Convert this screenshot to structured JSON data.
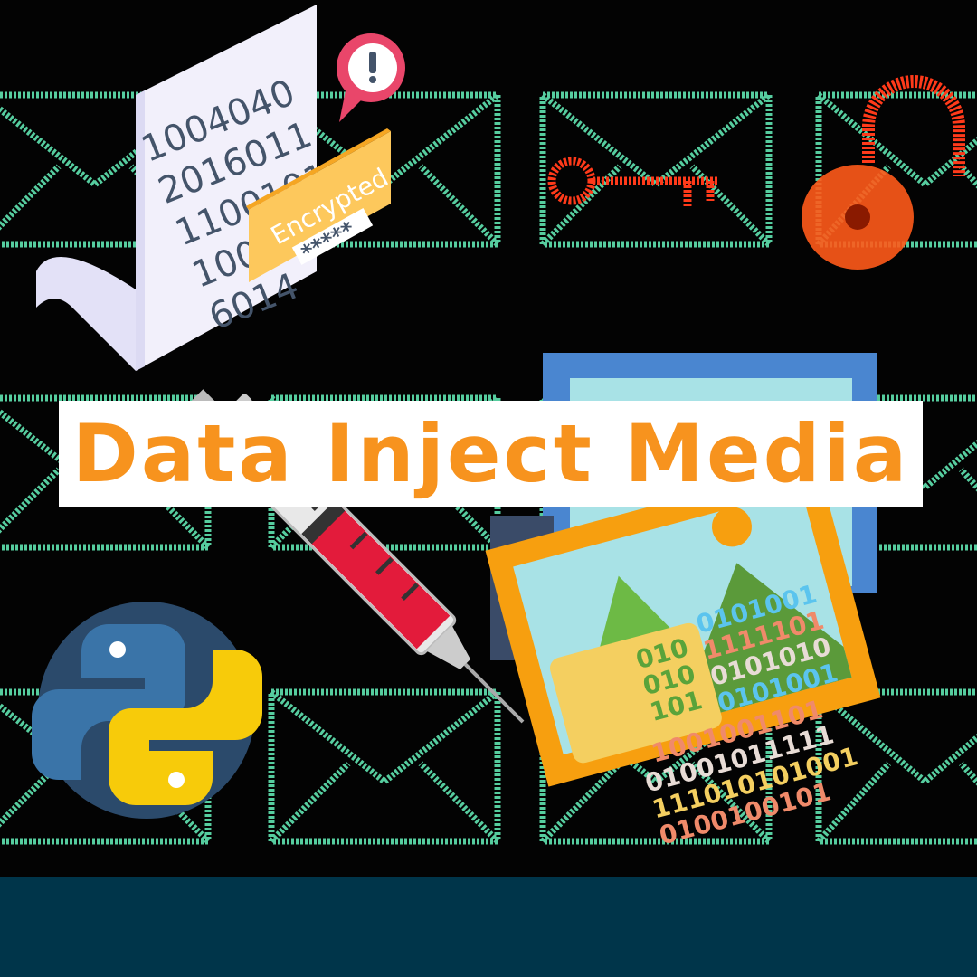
{
  "title": "Data Inject Media",
  "colors": {
    "accent_orange": "#f7931e",
    "envelope_green": "#5fe3b0",
    "footer_navy": "#00354a",
    "key_red": "#ff3a1a",
    "python_blue": "#3a74a8",
    "python_yellow": "#f7cb0a"
  },
  "document": {
    "lines": [
      "1004040",
      "2016011",
      "1100101",
      "1000",
      "6014"
    ],
    "badge_label": "Encrypted",
    "badge_password": "*****",
    "alert_icon": "exclamation-icon"
  },
  "image_card": {
    "chip_rows": [
      "010",
      "010",
      "101"
    ],
    "binary_rows": [
      "0101001",
      "1111101",
      "0101010",
      "0101001",
      "1001001101",
      "01001011111",
      "111010101001",
      "0100100101"
    ]
  },
  "icons": [
    "key-icon",
    "unlocked-padlock-icon",
    "syringe-icon",
    "python-logo-icon",
    "image-icon",
    "envelope-icon"
  ]
}
